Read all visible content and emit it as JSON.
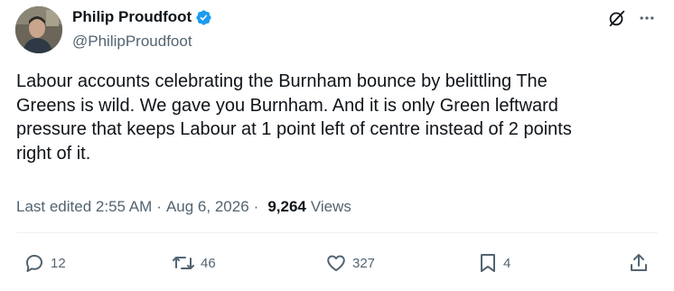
{
  "author": {
    "display_name": "Philip Proudfoot",
    "handle": "@PhilipProudfoot",
    "verified": true
  },
  "icons": {
    "verified": "verified-badge-icon",
    "grok": "grok-icon",
    "more": "more-options-icon",
    "reply": "reply-icon",
    "repost": "repost-icon",
    "like": "like-icon",
    "bookmark": "bookmark-icon",
    "share": "share-icon"
  },
  "colors": {
    "accent": "#1d9bf0",
    "text_primary": "#0f1419",
    "text_secondary": "#536471"
  },
  "tweet": {
    "text": "Labour accounts celebrating the Burnham bounce by belittling The\nGreens is wild. We gave you Burnham. And it is only Green leftward\npressure that keeps Labour at 1 point left of centre instead of 2 points\nright of it."
  },
  "meta": {
    "edited_label": "Last edited 2:55 AM",
    "separator": "·",
    "date": "Aug 6, 2026",
    "views_count": "9,264",
    "views_label": "Views"
  },
  "actions": {
    "replies": "12",
    "reposts": "46",
    "likes": "327",
    "bookmarks": "4"
  }
}
